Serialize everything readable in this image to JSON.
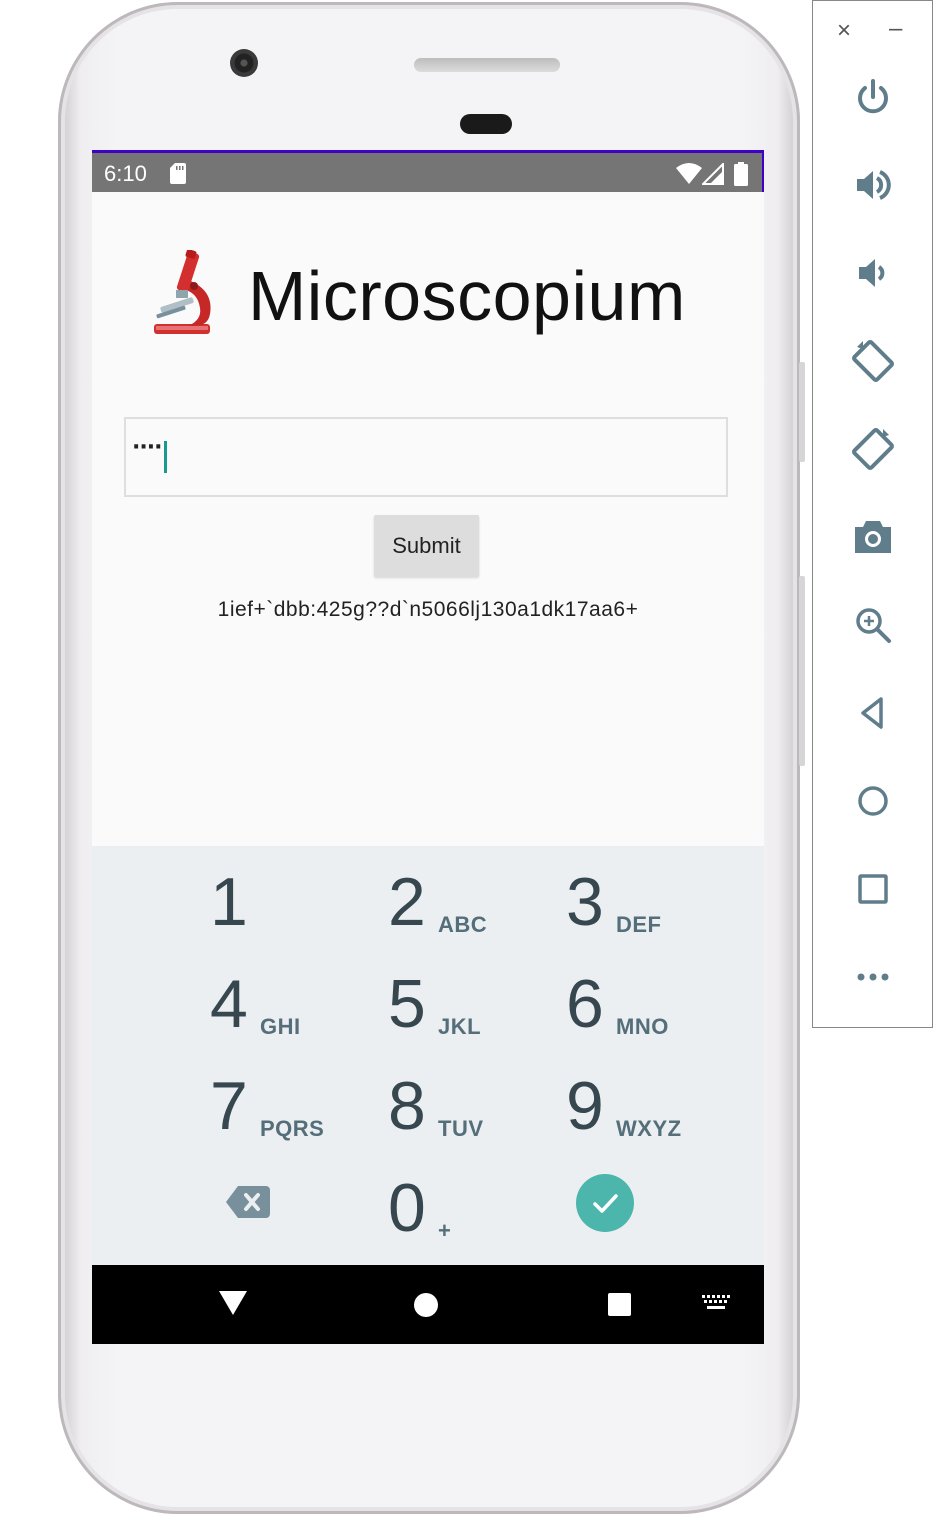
{
  "status_bar": {
    "time": "6:10"
  },
  "app": {
    "title": "Microscopium",
    "icon": "microscope-icon",
    "input": {
      "value": "····"
    },
    "submit_label": "Submit",
    "output": "1ief+`dbb:425g??d`n5066lj130a1dk17aa6+"
  },
  "keypad": {
    "keys": [
      {
        "digit": "1",
        "letters": ""
      },
      {
        "digit": "2",
        "letters": "ABC"
      },
      {
        "digit": "3",
        "letters": "DEF"
      },
      {
        "digit": "4",
        "letters": "GHI"
      },
      {
        "digit": "5",
        "letters": "JKL"
      },
      {
        "digit": "6",
        "letters": "MNO"
      },
      {
        "digit": "7",
        "letters": "PQRS"
      },
      {
        "digit": "8",
        "letters": "TUV"
      },
      {
        "digit": "9",
        "letters": "WXYZ"
      },
      {
        "digit": "0",
        "letters": "+"
      }
    ],
    "delete_icon": "backspace-icon",
    "done_icon": "check-icon",
    "done_color": "#4db6ac"
  },
  "nav_bar": {
    "icons": [
      "back-triangle-icon",
      "home-circle-icon",
      "recents-square-icon",
      "keyboard-icon"
    ]
  },
  "emulator_toolbar": {
    "close_glyph": "×",
    "minimize_glyph": "–",
    "buttons": [
      "power-icon",
      "volume-up-icon",
      "volume-down-icon",
      "rotate-left-icon",
      "rotate-right-icon",
      "screenshot-icon",
      "zoom-icon",
      "back-icon",
      "home-icon",
      "overview-icon",
      "more-icon"
    ]
  },
  "colors": {
    "status_bar": "#757575",
    "status_accent": "#3f00c8",
    "keypad_bg": "#eceff1",
    "caret": "#169b8c"
  }
}
